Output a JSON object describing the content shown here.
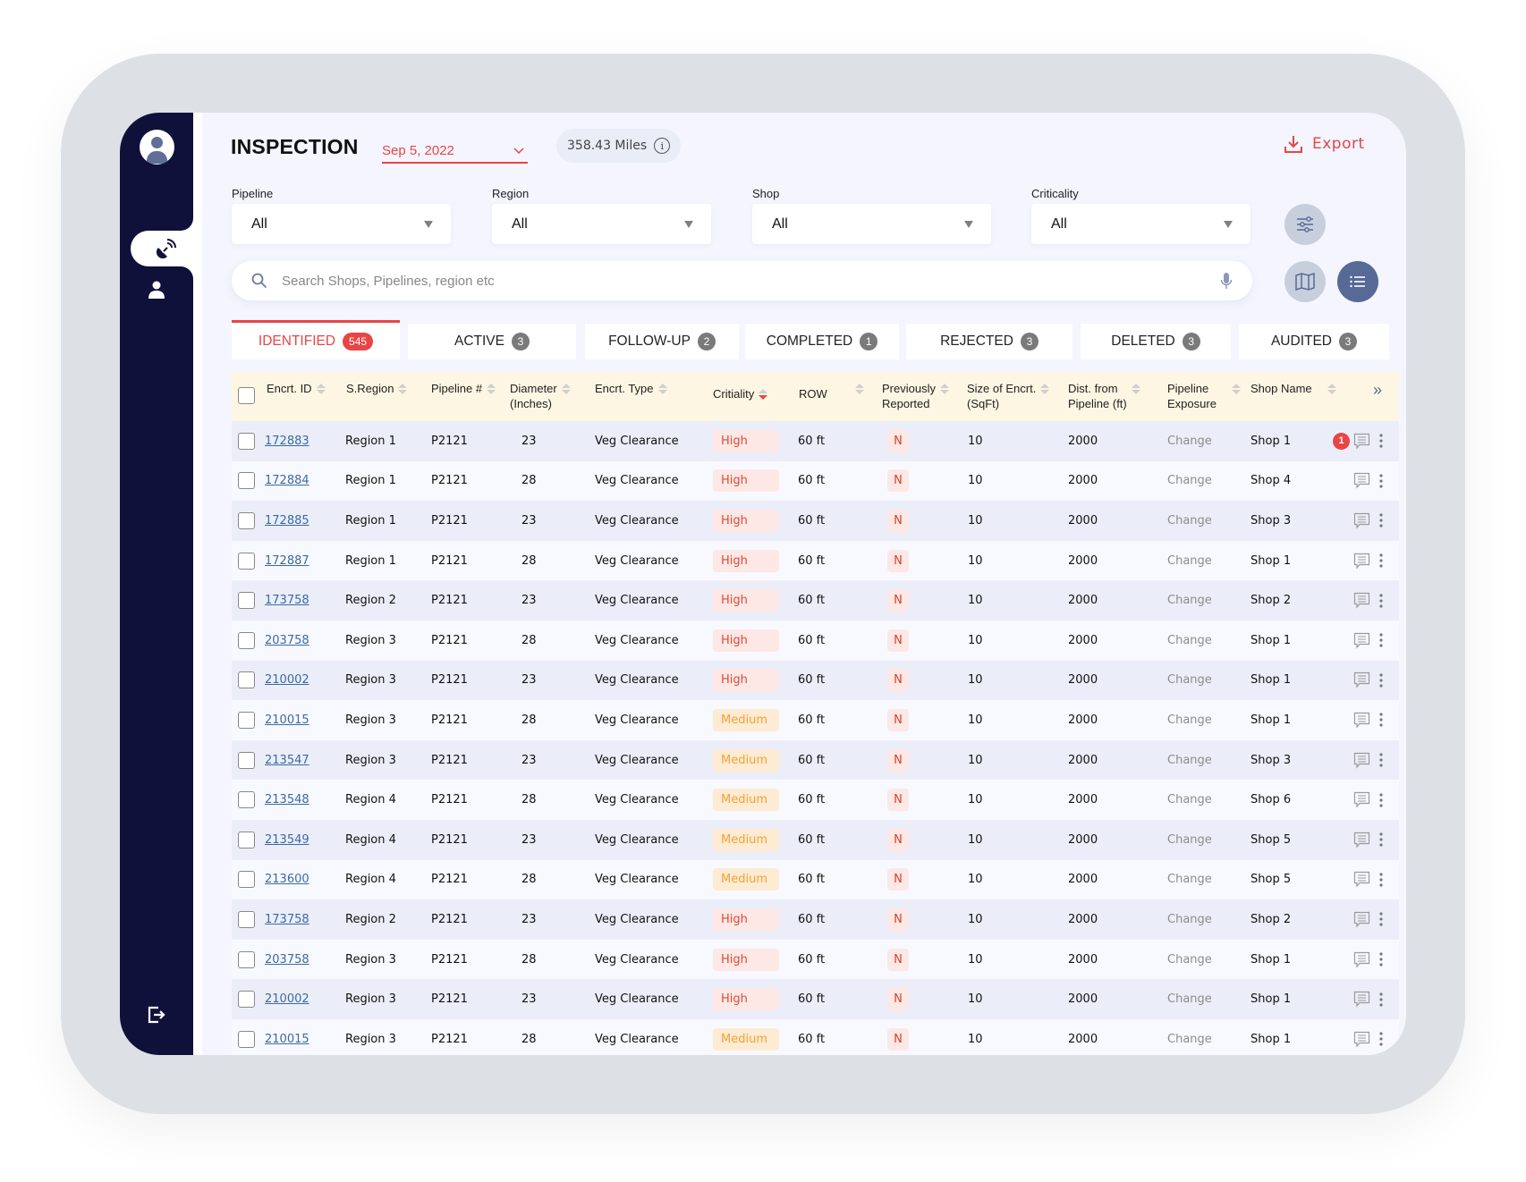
{
  "header": {
    "title": "INSPECTION",
    "date": "Sep 5, 2022",
    "miles": "358.43 Miles",
    "export_label": "Export"
  },
  "colors": {
    "accent": "#e84545",
    "sidebar": "#10113a",
    "link": "#3a6aa5",
    "high_bg": "#fde8e5",
    "high_text": "#e0493a",
    "medium_bg": "#fdebd3",
    "medium_text": "#f4a235",
    "header_bg": "#fdf6e3"
  },
  "filters": [
    {
      "label": "Pipeline",
      "value": "All"
    },
    {
      "label": "Region",
      "value": "All"
    },
    {
      "label": "Shop",
      "value": "All"
    },
    {
      "label": "Criticality",
      "value": "All"
    }
  ],
  "search": {
    "placeholder": "Search Shops, Pipelines, region etc",
    "value": ""
  },
  "tabs": [
    {
      "label": "IDENTIFIED",
      "count": "545",
      "active": true
    },
    {
      "label": "ACTIVE",
      "count": "3"
    },
    {
      "label": "FOLLOW-UP",
      "count": "2"
    },
    {
      "label": "COMPLETED",
      "count": "1"
    },
    {
      "label": "REJECTED",
      "count": "3"
    },
    {
      "label": "DELETED",
      "count": "3"
    },
    {
      "label": "AUDITED",
      "count": "3"
    }
  ],
  "table": {
    "columns": [
      {
        "l1": "Encrt. ID",
        "l2": ""
      },
      {
        "l1": "S.Region",
        "l2": ""
      },
      {
        "l1": "Pipeline #",
        "l2": ""
      },
      {
        "l1": "Diameter",
        "l2": "(Inches)"
      },
      {
        "l1": "Encrt. Type",
        "l2": ""
      },
      {
        "l1": "Critiality",
        "l2": ""
      },
      {
        "l1": "ROW",
        "l2": ""
      },
      {
        "l1": "Previously",
        "l2": "Reported"
      },
      {
        "l1": "Size of Encrt.",
        "l2": "(SqFt)"
      },
      {
        "l1": "Dist. from",
        "l2": "Pipeline (ft)"
      },
      {
        "l1": "Pipeline",
        "l2": "Exposure"
      },
      {
        "l1": "Shop Name",
        "l2": ""
      }
    ],
    "expand_icon": "»",
    "rows": [
      {
        "id": "172883",
        "region": "Region 1",
        "pipeline": "P2121",
        "diameter": "23",
        "type": "Veg Clearance",
        "criticality": "High",
        "row": "60 ft",
        "prev": "N",
        "size": "10",
        "dist": "2000",
        "exposure": "Change",
        "shop": "Shop 1",
        "notifications": "1"
      },
      {
        "id": "172884",
        "region": "Region 1",
        "pipeline": "P2121",
        "diameter": "28",
        "type": "Veg Clearance",
        "criticality": "High",
        "row": "60 ft",
        "prev": "N",
        "size": "10",
        "dist": "2000",
        "exposure": "Change",
        "shop": "Shop 4"
      },
      {
        "id": "172885",
        "region": "Region 1",
        "pipeline": "P2121",
        "diameter": "23",
        "type": "Veg Clearance",
        "criticality": "High",
        "row": "60 ft",
        "prev": "N",
        "size": "10",
        "dist": "2000",
        "exposure": "Change",
        "shop": "Shop 3"
      },
      {
        "id": "172887",
        "region": "Region 1",
        "pipeline": "P2121",
        "diameter": "28",
        "type": "Veg Clearance",
        "criticality": "High",
        "row": "60 ft",
        "prev": "N",
        "size": "10",
        "dist": "2000",
        "exposure": "Change",
        "shop": "Shop 1"
      },
      {
        "id": "173758",
        "region": "Region 2",
        "pipeline": "P2121",
        "diameter": "23",
        "type": "Veg Clearance",
        "criticality": "High",
        "row": "60 ft",
        "prev": "N",
        "size": "10",
        "dist": "2000",
        "exposure": "Change",
        "shop": "Shop 2"
      },
      {
        "id": "203758",
        "region": "Region 3",
        "pipeline": "P2121",
        "diameter": "28",
        "type": "Veg Clearance",
        "criticality": "High",
        "row": "60 ft",
        "prev": "N",
        "size": "10",
        "dist": "2000",
        "exposure": "Change",
        "shop": "Shop 1"
      },
      {
        "id": "210002",
        "region": "Region 3",
        "pipeline": "P2121",
        "diameter": "23",
        "type": "Veg Clearance",
        "criticality": "High",
        "row": "60 ft",
        "prev": "N",
        "size": "10",
        "dist": "2000",
        "exposure": "Change",
        "shop": "Shop 1"
      },
      {
        "id": "210015",
        "region": "Region 3",
        "pipeline": "P2121",
        "diameter": "28",
        "type": "Veg Clearance",
        "criticality": "Medium",
        "row": "60 ft",
        "prev": "N",
        "size": "10",
        "dist": "2000",
        "exposure": "Change",
        "shop": "Shop 1"
      },
      {
        "id": "213547",
        "region": "Region 3",
        "pipeline": "P2121",
        "diameter": "23",
        "type": "Veg Clearance",
        "criticality": "Medium",
        "row": "60 ft",
        "prev": "N",
        "size": "10",
        "dist": "2000",
        "exposure": "Change",
        "shop": "Shop 3"
      },
      {
        "id": "213548",
        "region": "Region 4",
        "pipeline": "P2121",
        "diameter": "28",
        "type": "Veg Clearance",
        "criticality": "Medium",
        "row": "60 ft",
        "prev": "N",
        "size": "10",
        "dist": "2000",
        "exposure": "Change",
        "shop": "Shop 6"
      },
      {
        "id": "213549",
        "region": "Region 4",
        "pipeline": "P2121",
        "diameter": "23",
        "type": "Veg Clearance",
        "criticality": "Medium",
        "row": "60 ft",
        "prev": "N",
        "size": "10",
        "dist": "2000",
        "exposure": "Change",
        "shop": "Shop 5"
      },
      {
        "id": "213600",
        "region": "Region 4",
        "pipeline": "P2121",
        "diameter": "28",
        "type": "Veg Clearance",
        "criticality": "Medium",
        "row": "60 ft",
        "prev": "N",
        "size": "10",
        "dist": "2000",
        "exposure": "Change",
        "shop": "Shop 5"
      },
      {
        "id": "173758",
        "region": "Region 2",
        "pipeline": "P2121",
        "diameter": "23",
        "type": "Veg Clearance",
        "criticality": "High",
        "row": "60 ft",
        "prev": "N",
        "size": "10",
        "dist": "2000",
        "exposure": "Change",
        "shop": "Shop 2"
      },
      {
        "id": "203758",
        "region": "Region 3",
        "pipeline": "P2121",
        "diameter": "28",
        "type": "Veg Clearance",
        "criticality": "High",
        "row": "60 ft",
        "prev": "N",
        "size": "10",
        "dist": "2000",
        "exposure": "Change",
        "shop": "Shop 1"
      },
      {
        "id": "210002",
        "region": "Region 3",
        "pipeline": "P2121",
        "diameter": "23",
        "type": "Veg Clearance",
        "criticality": "High",
        "row": "60 ft",
        "prev": "N",
        "size": "10",
        "dist": "2000",
        "exposure": "Change",
        "shop": "Shop 1"
      },
      {
        "id": "210015",
        "region": "Region 3",
        "pipeline": "P2121",
        "diameter": "28",
        "type": "Veg Clearance",
        "criticality": "Medium",
        "row": "60 ft",
        "prev": "N",
        "size": "10",
        "dist": "2000",
        "exposure": "Change",
        "shop": "Shop 1"
      }
    ]
  }
}
